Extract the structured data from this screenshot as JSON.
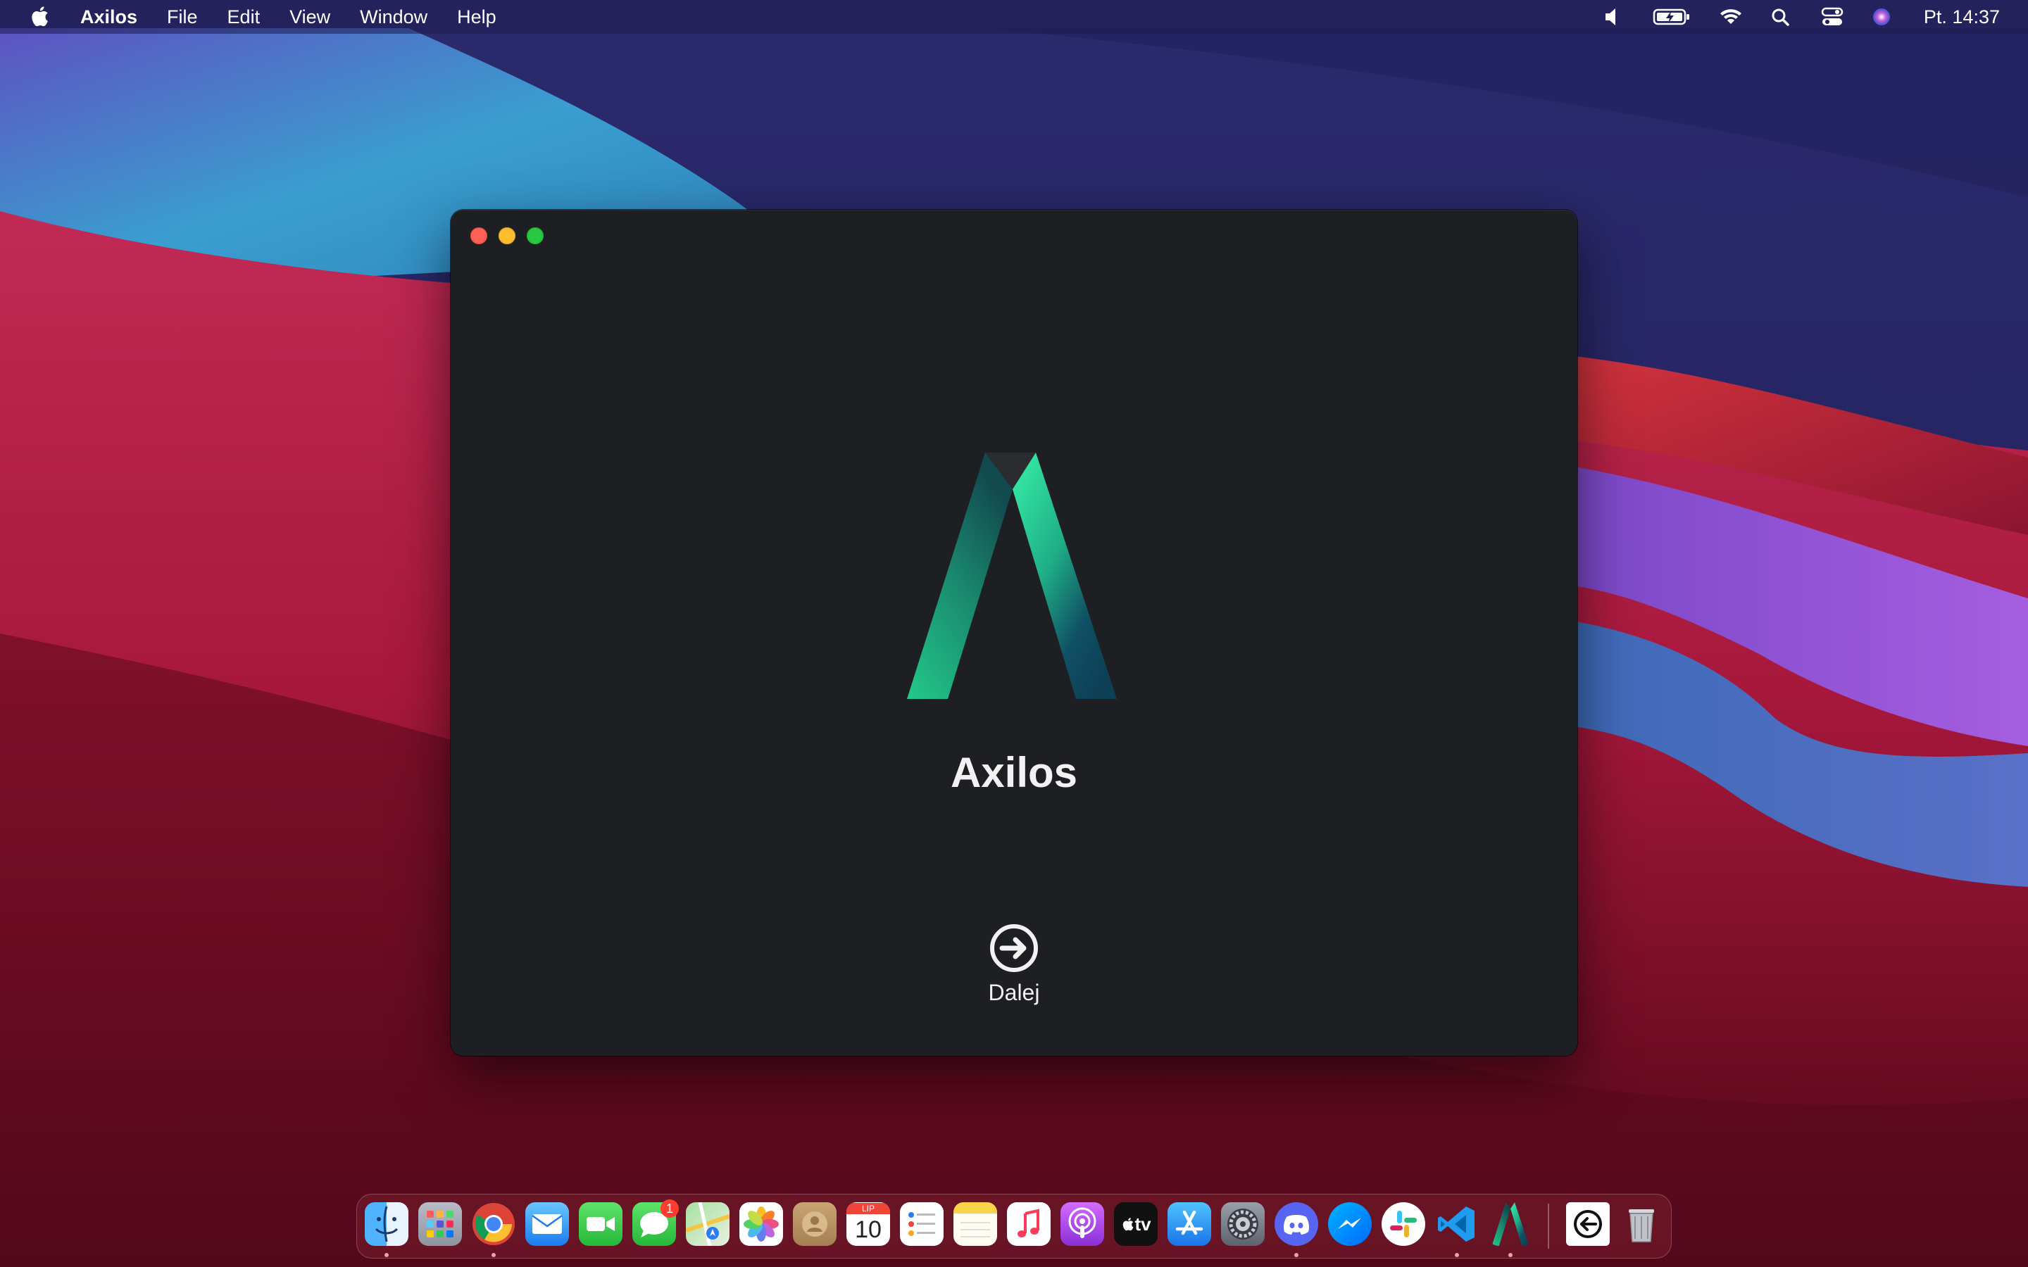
{
  "menubar": {
    "app_name": "Axilos",
    "items": [
      "File",
      "Edit",
      "View",
      "Window",
      "Help"
    ],
    "clock": "Pt. 14:37"
  },
  "window": {
    "app_title": "Axilos",
    "next_label": "Dalej"
  },
  "dock": {
    "apps": [
      {
        "name": "Finder",
        "running": true
      },
      {
        "name": "Launchpad",
        "running": false
      },
      {
        "name": "Google Chrome",
        "running": true
      },
      {
        "name": "Mail",
        "running": false
      },
      {
        "name": "FaceTime",
        "running": false
      },
      {
        "name": "Messages",
        "running": false,
        "badge": "1"
      },
      {
        "name": "Maps",
        "running": false
      },
      {
        "name": "Photos",
        "running": false
      },
      {
        "name": "Contacts",
        "running": false
      },
      {
        "name": "Calendar",
        "running": false,
        "month": "LIP",
        "day": "10"
      },
      {
        "name": "Reminders",
        "running": false
      },
      {
        "name": "Notes",
        "running": false
      },
      {
        "name": "Music",
        "running": false
      },
      {
        "name": "Podcasts",
        "running": false
      },
      {
        "name": "TV",
        "running": false,
        "label": "tv"
      },
      {
        "name": "App Store",
        "running": false
      },
      {
        "name": "System Preferences",
        "running": false
      },
      {
        "name": "Discord",
        "running": true
      },
      {
        "name": "Messenger",
        "running": false
      },
      {
        "name": "Slack",
        "running": false
      },
      {
        "name": "Visual Studio Code",
        "running": true
      },
      {
        "name": "Axilos",
        "running": true
      },
      {
        "name": "Downloads",
        "running": false
      },
      {
        "name": "Trash",
        "running": false
      }
    ]
  },
  "colors": {
    "window_bg": "#1e1f22",
    "logo_green": "#2ee89c",
    "logo_dark": "#0f4a5a"
  }
}
